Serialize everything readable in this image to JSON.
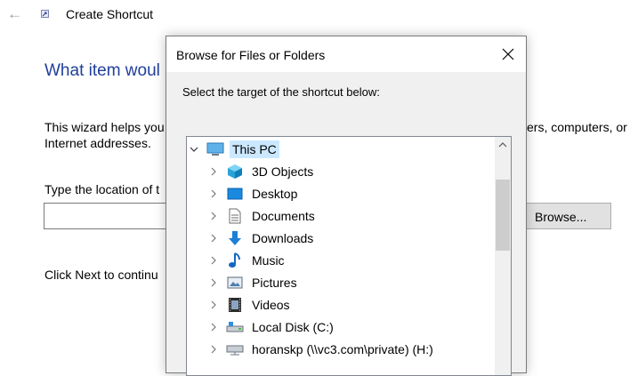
{
  "wizard": {
    "title": "Create Shortcut",
    "heading": "What item woul",
    "description_line1_left": "This wizard helps you",
    "description_line1_right": "ers, computers, or",
    "description_line2": "Internet addresses.",
    "location_label": "Type the location of t",
    "location_value": "",
    "browse_label": "Browse...",
    "next_text": "Click Next to continu"
  },
  "dialog": {
    "title": "Browse for Files or Folders",
    "prompt": "Select the target of the shortcut below:",
    "tree": [
      {
        "label": "This PC",
        "icon": "this-pc-icon",
        "expanded": true,
        "selected": true
      },
      {
        "label": "3D Objects",
        "icon": "3d-objects-icon"
      },
      {
        "label": "Desktop",
        "icon": "desktop-icon"
      },
      {
        "label": "Documents",
        "icon": "documents-icon"
      },
      {
        "label": "Downloads",
        "icon": "downloads-icon"
      },
      {
        "label": "Music",
        "icon": "music-icon"
      },
      {
        "label": "Pictures",
        "icon": "pictures-icon"
      },
      {
        "label": "Videos",
        "icon": "videos-icon"
      },
      {
        "label": "Local Disk (C:)",
        "icon": "local-disk-icon"
      },
      {
        "label": "horanskp (\\\\vc3.com\\private) (H:)",
        "icon": "network-drive-icon"
      }
    ]
  },
  "colors": {
    "heading": "#1f3f9a",
    "selection": "#cce8ff",
    "dialog_bg": "#f0f0f0"
  }
}
